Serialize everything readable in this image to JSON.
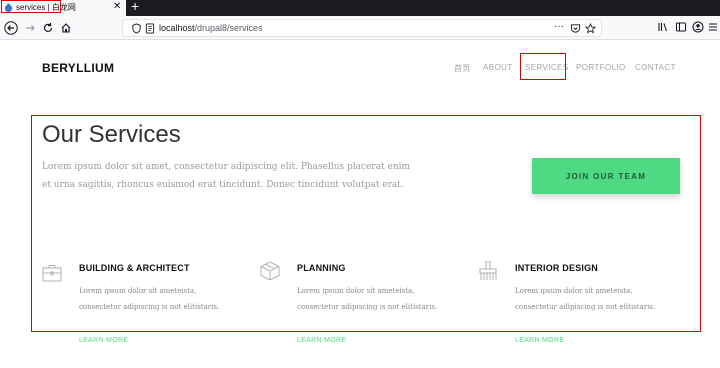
{
  "browser": {
    "tab_title": "services | 白龙网",
    "url_host": "localhost",
    "url_path": "/drupal8/services"
  },
  "site": {
    "brand": "BERYLLIUM",
    "menu": [
      "首页",
      "ABOUT",
      "SERVICES",
      "PORTFOLIO",
      "CONTACT"
    ]
  },
  "section": {
    "title": "Our Services",
    "lede": "Lorem ipsum dolor sit amet, consectetur adipiscing elit. Phasellus placerat enim et urna sagittis, rhoncus euismod erat tincidunt. Donec tincidunt volutpat erat.",
    "cta": "JOIN OUR TEAM"
  },
  "services": [
    {
      "title": "BUILDING & ARCHITECT",
      "desc": "Lorem ipsum dolor sit ameteista, consectetur adipiscing is not elitistaris.",
      "link": "LEARN MORE",
      "icon": "briefcase-icon"
    },
    {
      "title": "PLANNING",
      "desc": "Lorem ipsum dolor sit ameteista, consectetur adipiscing is not elitistaris.",
      "link": "LEARN MORE",
      "icon": "box-icon"
    },
    {
      "title": "INTERIOR DESIGN",
      "desc": "Lorem ipsum dolor sit ameteista, consectetur adipiscing is not elitistaris.",
      "link": "LEARN MORE",
      "icon": "paint-brush-icon"
    }
  ],
  "colors": {
    "accent": "#50d983",
    "highlight": "#e00000"
  }
}
